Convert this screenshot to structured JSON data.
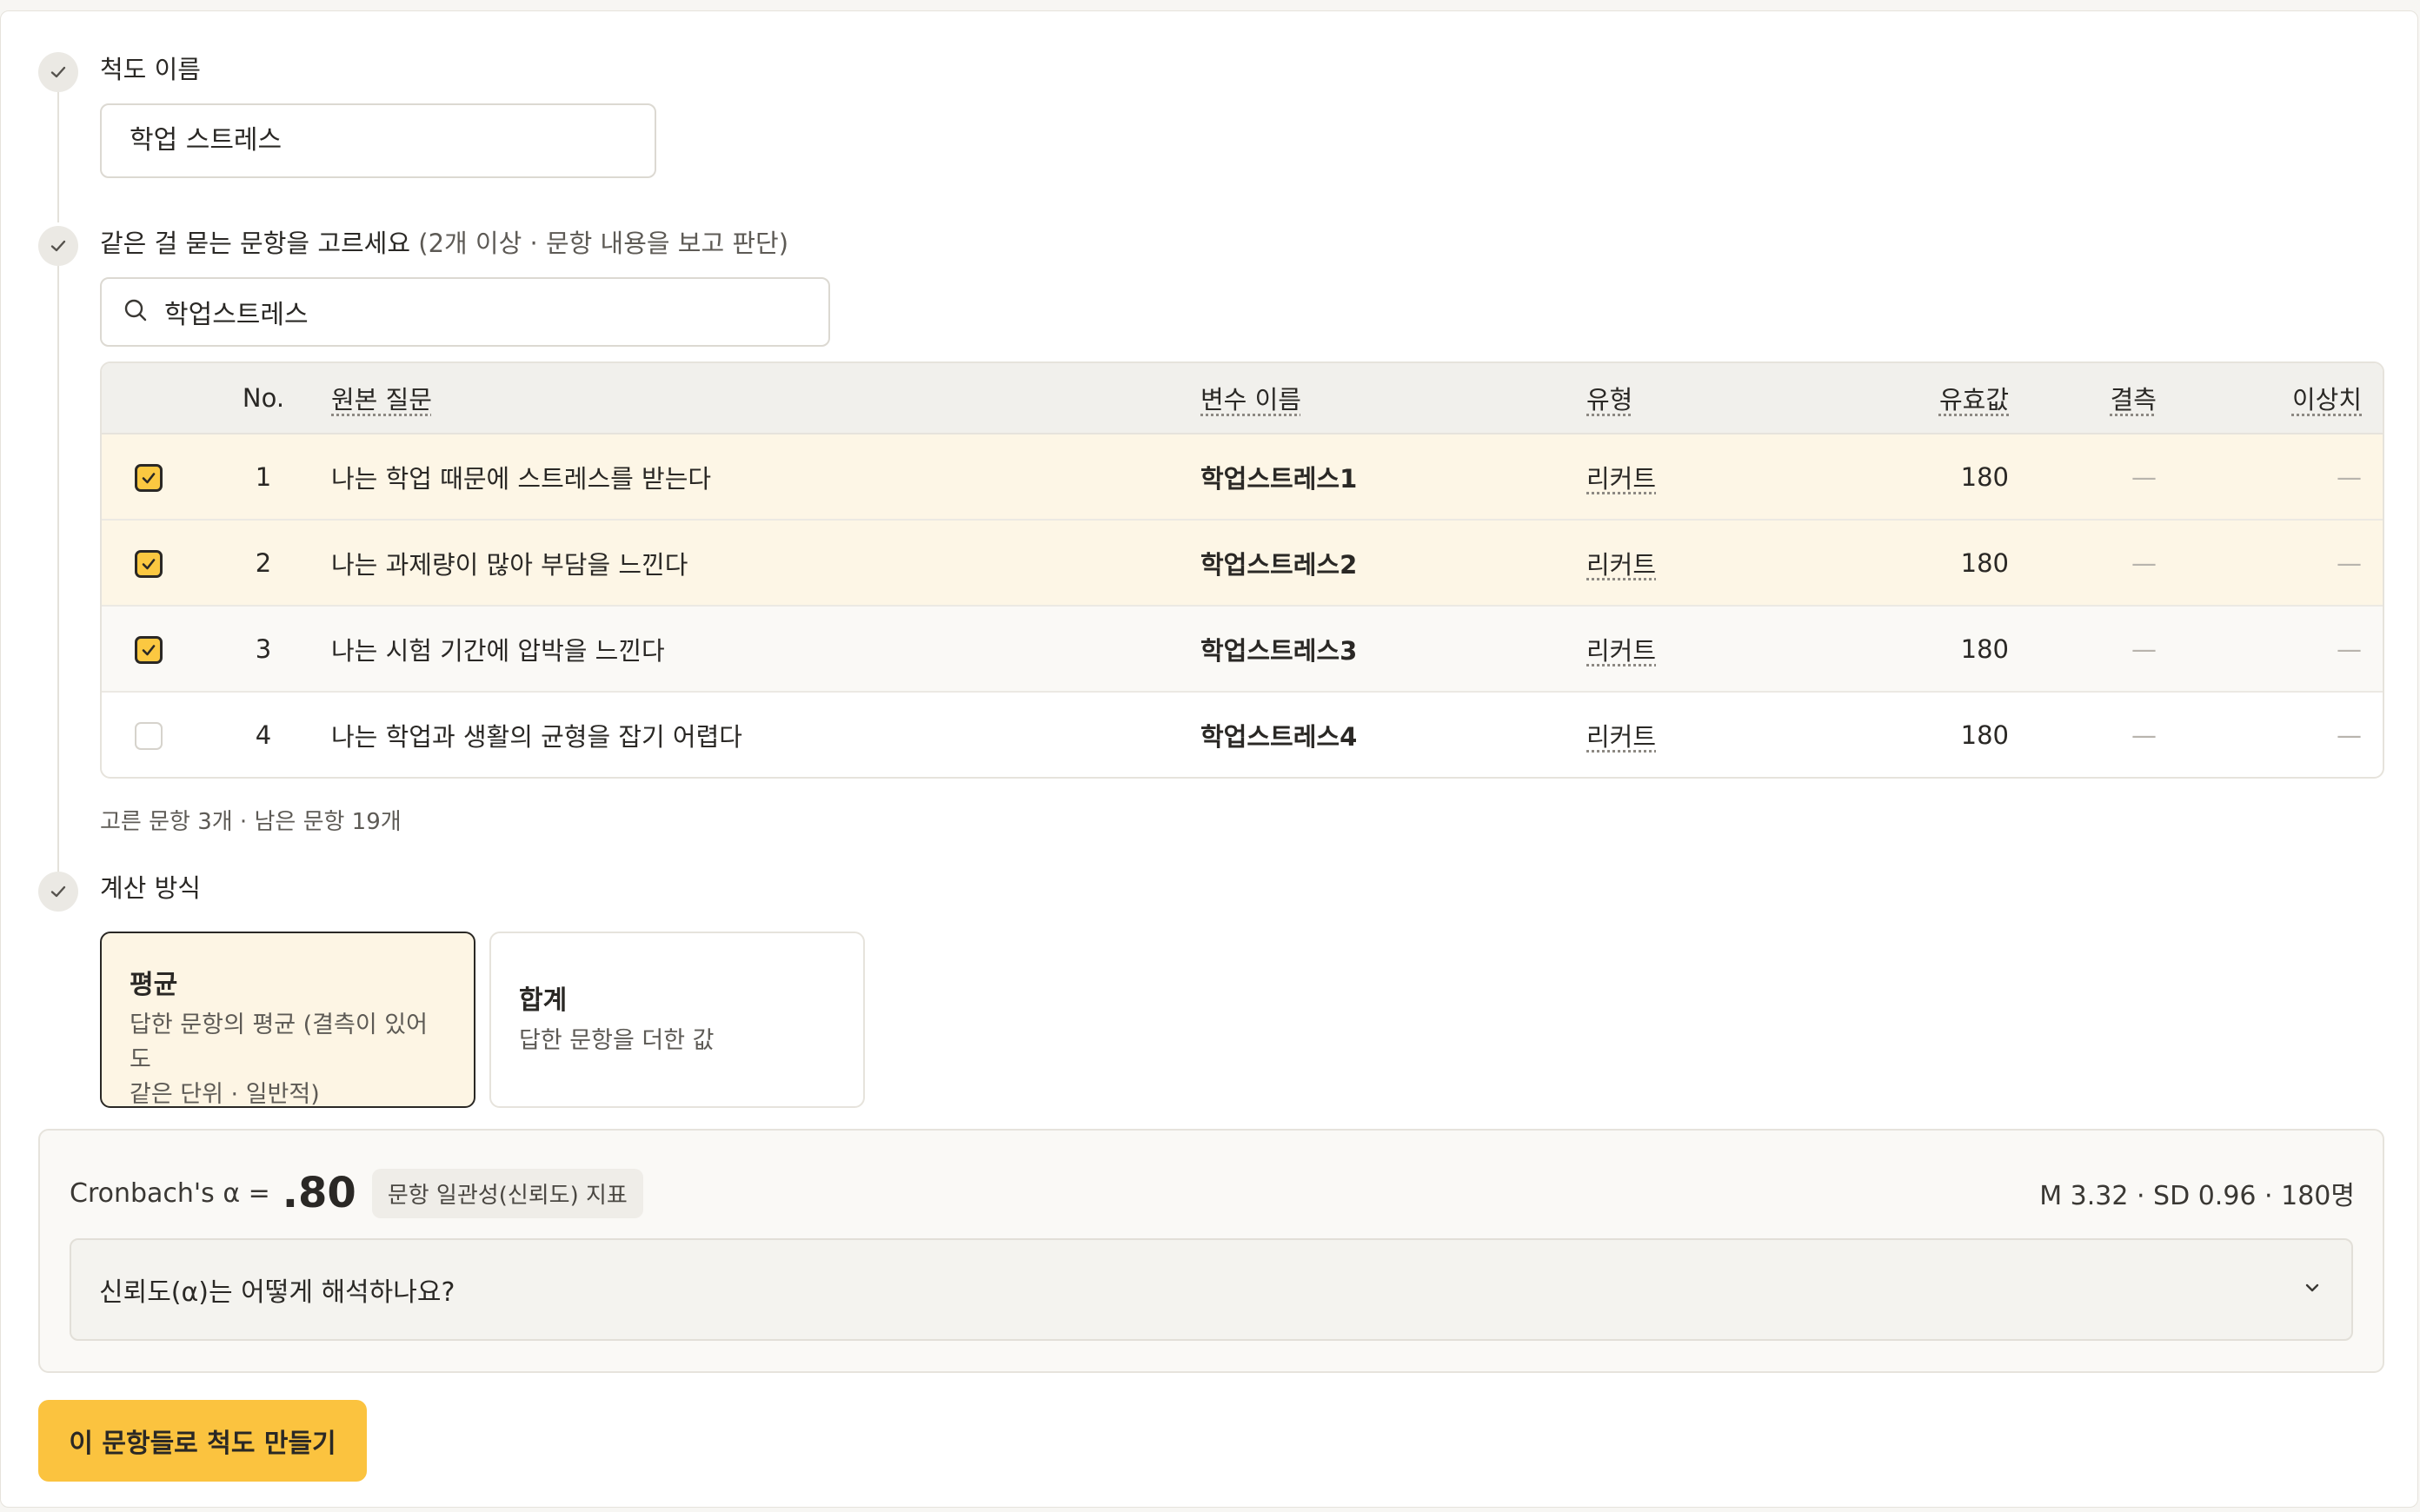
{
  "steps": {
    "name": {
      "label": "척도 이름",
      "value": "학업 스트레스"
    },
    "items": {
      "label": "같은 걸 묻는 문항을 고르세요",
      "hint": "(2개 이상 · 문항 내용을 보고 판단)",
      "search_value": "학업스트레스"
    },
    "method": {
      "label": "계산 방식"
    }
  },
  "table": {
    "headers": {
      "no": "No.",
      "question": "원본 질문",
      "variable": "변수 이름",
      "type": "유형",
      "valid": "유효값",
      "missing": "결측",
      "outlier": "이상치"
    },
    "rows": [
      {
        "checked": true,
        "no": "1",
        "question": "나는 학업 때문에 스트레스를 받는다",
        "variable": "학업스트레스1",
        "type": "리커트",
        "valid": "180",
        "missing": "—",
        "outlier": "—"
      },
      {
        "checked": true,
        "no": "2",
        "question": "나는 과제량이 많아 부담을 느낀다",
        "variable": "학업스트레스2",
        "type": "리커트",
        "valid": "180",
        "missing": "—",
        "outlier": "—"
      },
      {
        "checked": true,
        "no": "3",
        "question": "나는 시험 기간에 압박을 느낀다",
        "variable": "학업스트레스3",
        "type": "리커트",
        "valid": "180",
        "missing": "—",
        "outlier": "—"
      },
      {
        "checked": false,
        "no": "4",
        "question": "나는 학업과 생활의 균형을 잡기 어렵다",
        "variable": "학업스트레스4",
        "type": "리커트",
        "valid": "180",
        "missing": "—",
        "outlier": "—"
      }
    ]
  },
  "selection_summary": "고른 문항 3개 · 남은 문항 19개",
  "methods": [
    {
      "title": "평균",
      "desc_line1": "답한 문항의 평균 (결측이 있어도",
      "desc_line2": "같은 단위 · 일반적)",
      "selected": true
    },
    {
      "title": "합계",
      "desc_line1": "답한 문항을 더한 값",
      "selected": false
    }
  ],
  "reliability": {
    "label": "Cronbach's α =",
    "value": ".80",
    "badge": "문항 일관성(신뢰도) 지표",
    "stats": "M 3.32 · SD 0.96 · 180명",
    "accordion_question": "신뢰도(α)는 어떻게 해석하나요?"
  },
  "create_button": "이 문항들로 척도 만들기",
  "colors": {
    "accent": "#fbc33f",
    "selected_row_bg": "#fdf6e6",
    "text": "#2a2825",
    "muted": "#5d5a55"
  }
}
